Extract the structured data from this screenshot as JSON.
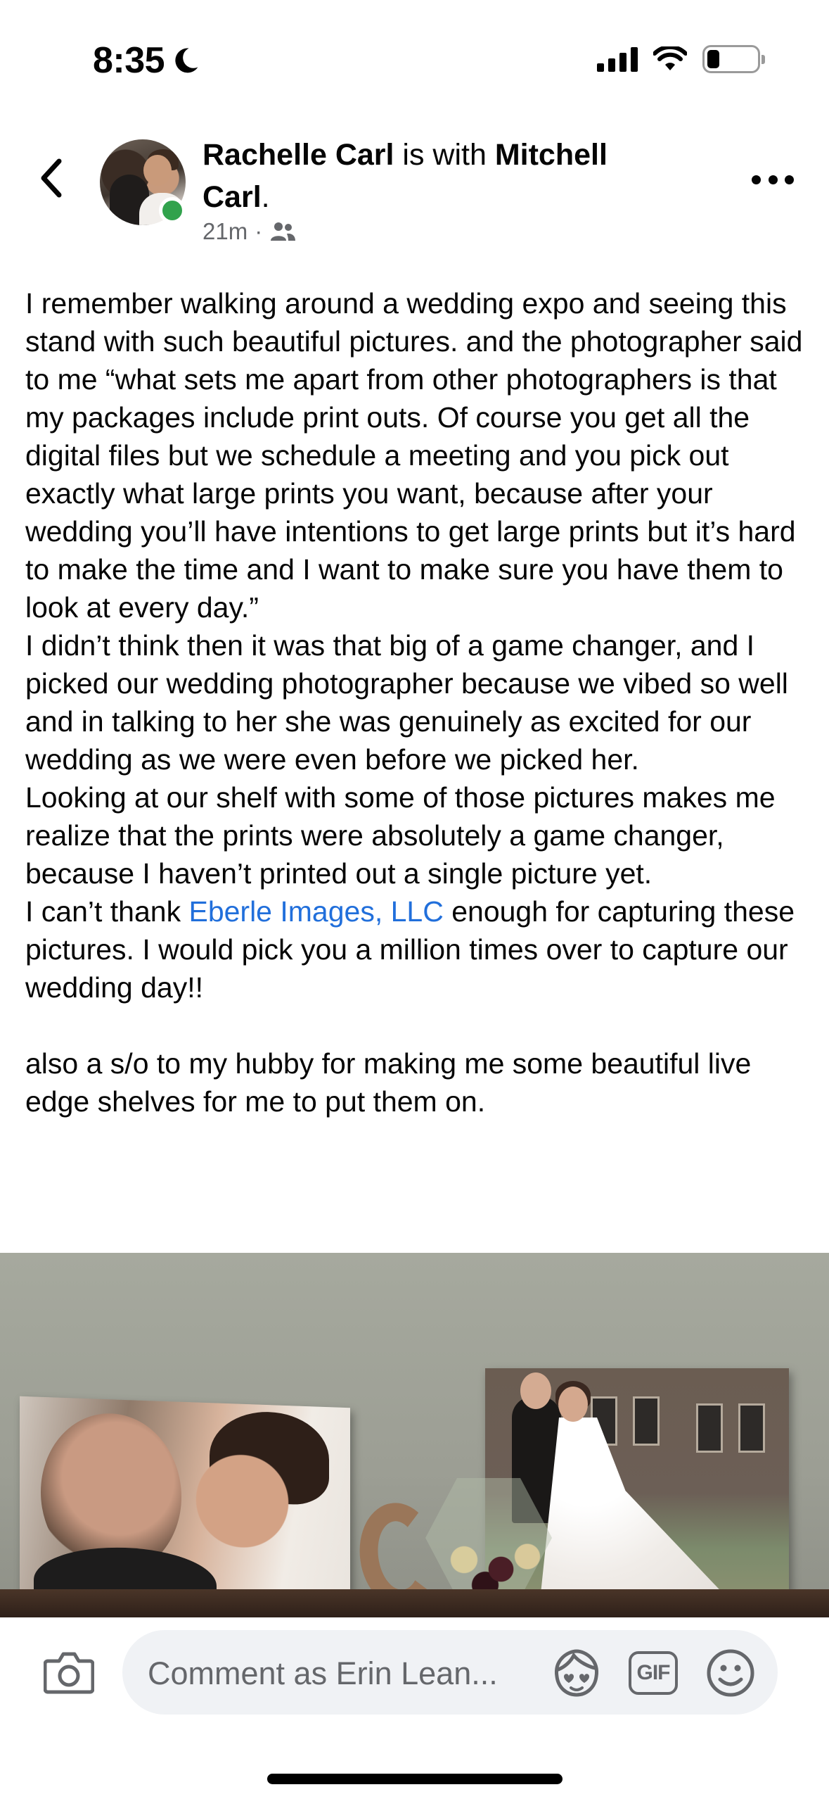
{
  "status_bar": {
    "time": "8:35",
    "battery_level": 0.25
  },
  "post": {
    "author": "Rachelle Carl",
    "with_text": "is with",
    "tagged": "Mitchell",
    "tagged_line2": "Carl",
    "period": ".",
    "timestamp": "21m",
    "separator": "·",
    "audience_icon": "friends-icon",
    "paragraphs": [
      "I remember walking around a wedding expo and seeing this stand with such beautiful pictures. and the photographer said to me “what sets me apart from other photographers is that my packages include print outs. Of course you get all the digital files but we schedule a meeting and you pick out exactly what large prints you want, because after your wedding you’ll have intentions to get large prints but it’s hard to make the time and I want to make sure you have them to look at every day.”",
      "I didn’t think then it was that big of a game changer, and I picked our wedding photographer because we vibed so well and in talking to her she was genuinely as excited for our wedding as we were even before we picked her.",
      "Looking at our shelf with some of those pictures makes me realize that the prints were absolutely a game changer, because I haven’t printed out a single picture yet."
    ],
    "thanks_before": "I can’t thank ",
    "mention": "Eberle Images, LLC",
    "thanks_after": " enough for capturing these pictures. I would pick you a million times over to capture our wedding day!!",
    "closing": "also a s/o to my hubby for making me some beautiful live edge shelves for me to put them on."
  },
  "comment_bar": {
    "placeholder": "Comment as Erin Lean...",
    "gif_label": "GIF"
  },
  "colors": {
    "link": "#216fdb",
    "secondary_text": "#65676b",
    "online": "#31a24c",
    "input_bg": "#f0f2f5"
  }
}
